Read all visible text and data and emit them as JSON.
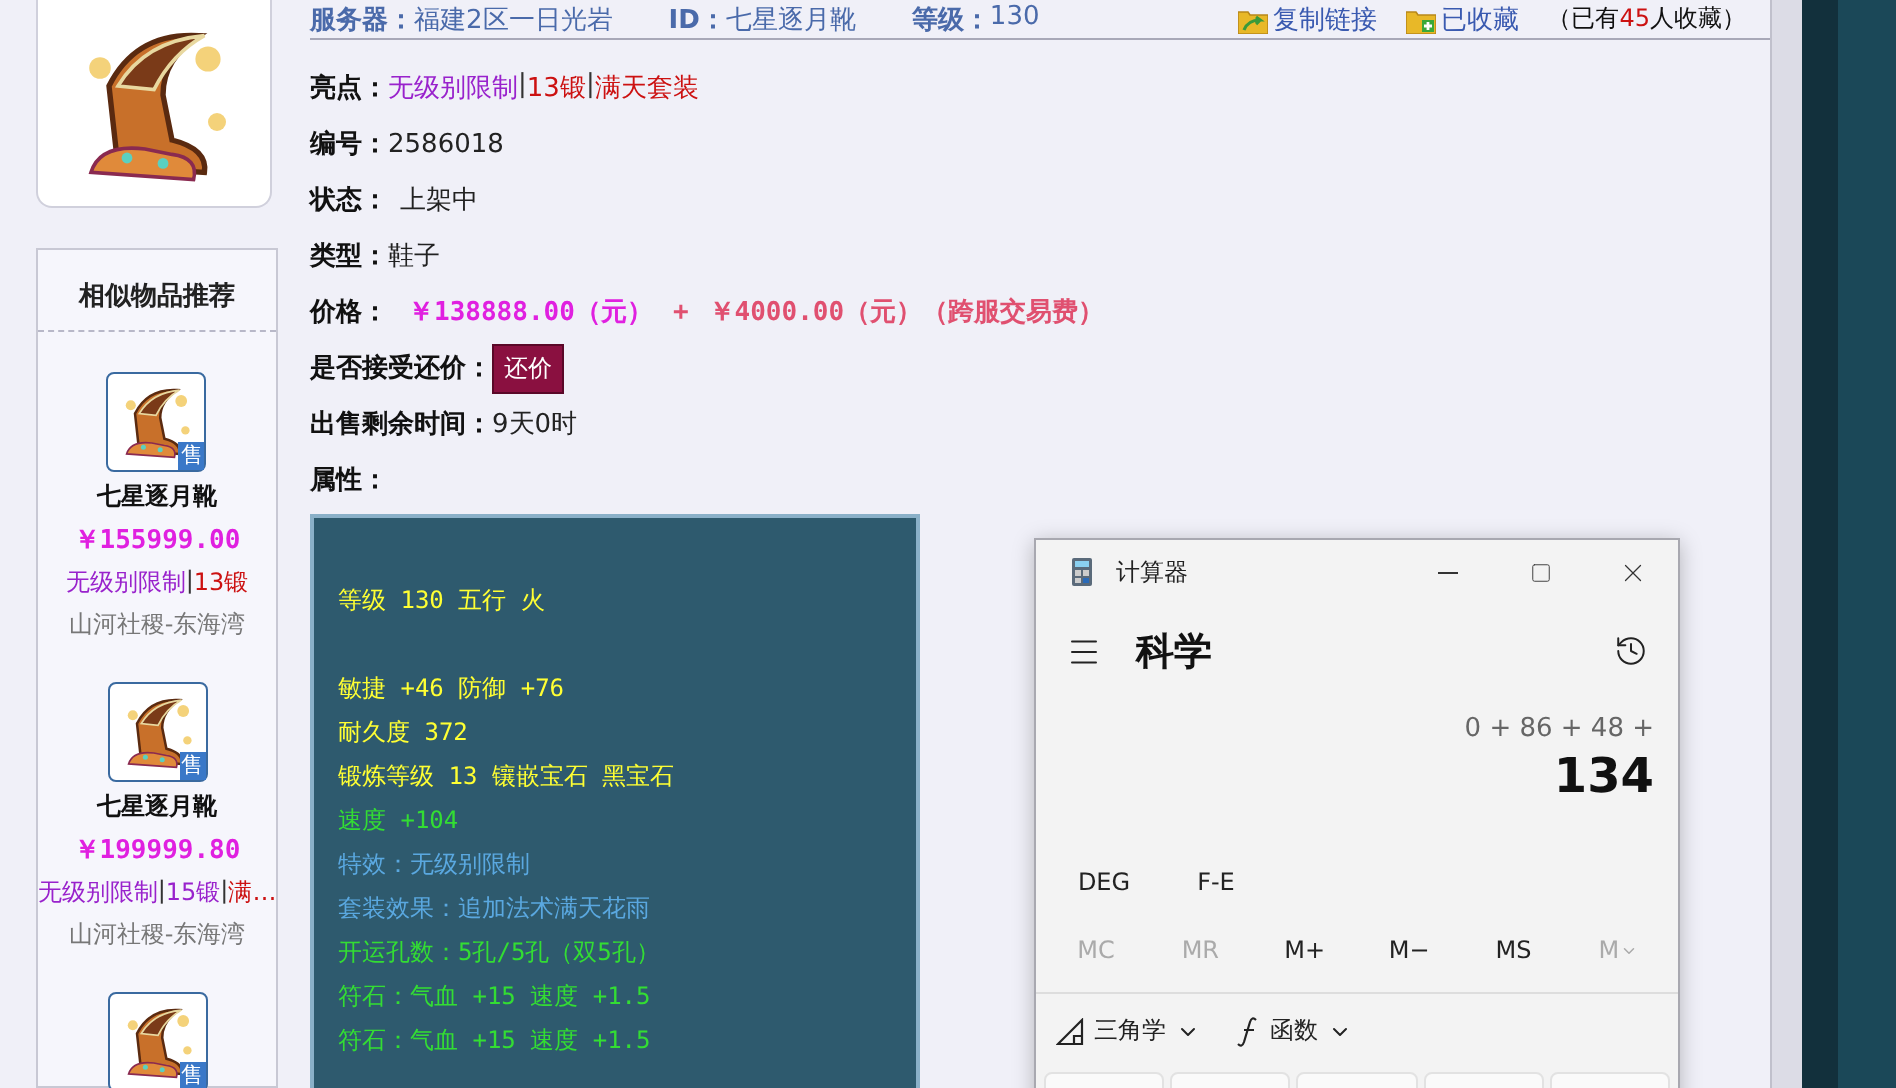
{
  "similar": {
    "title": "相似物品推荐",
    "items": [
      {
        "name": "七星逐月靴",
        "price": "￥155999.00",
        "badge": "售",
        "tags": [
          {
            "text": "无级别限制",
            "color": "#9922cc"
          },
          {
            "text": "|",
            "color": "#333333"
          },
          {
            "text": "13锻",
            "color": "#cc1111"
          }
        ],
        "server": "山河社稷-东海湾"
      },
      {
        "name": "七星逐月靴",
        "price": "￥199999.80",
        "badge": "售",
        "tags": [
          {
            "text": "无级别限制",
            "color": "#9922cc"
          },
          {
            "text": "|",
            "color": "#333333"
          },
          {
            "text": "15锻",
            "color": "#9922cc"
          },
          {
            "text": "|",
            "color": "#333333"
          },
          {
            "text": "满…",
            "color": "#cc1111"
          }
        ],
        "server": "山河社稷-东海湾"
      },
      {
        "badge": "售"
      }
    ]
  },
  "header": {
    "fields": [
      {
        "label": "服务器：",
        "value": "福建2区一日光岩"
      },
      {
        "label": "ID：",
        "value": "七星逐月靴"
      },
      {
        "label": "等级：",
        "value": "130"
      }
    ],
    "links": [
      "复制链接",
      "已收藏"
    ],
    "fav_count": [
      {
        "text": "（已有",
        "color": "#111111"
      },
      {
        "text": "45",
        "color": "#cc1111"
      },
      {
        "text": "人收藏）",
        "color": "#111111"
      }
    ]
  },
  "details": [
    {
      "label": "亮点：",
      "kind": "tags",
      "tags": [
        {
          "text": "无级别限制",
          "color": "#9922cc"
        },
        {
          "text": "|",
          "color": "#333333"
        },
        {
          "text": "13锻",
          "color": "#cc1111"
        },
        {
          "text": "|",
          "color": "#333333"
        },
        {
          "text": "满天套装",
          "color": "#cc1111"
        }
      ]
    },
    {
      "label": "编号：",
      "kind": "text",
      "value": "2586018"
    },
    {
      "label": "状态：",
      "kind": "text",
      "value": "上架中"
    },
    {
      "label": "类型：",
      "kind": "text",
      "value": "鞋子"
    },
    {
      "label": "价格：",
      "kind": "price",
      "parts": [
        {
          "text": "￥138888.00（元）",
          "color": "#e020e0"
        },
        {
          "text": "+",
          "color": "#e05070"
        },
        {
          "text": "￥4000.00（元）（跨服交易费）",
          "color": "#e05070"
        }
      ]
    },
    {
      "label": "是否接受还价：",
      "kind": "button",
      "value": "还价"
    },
    {
      "label": "出售剩余时间：",
      "kind": "text",
      "value": "9天0时"
    },
    {
      "label": "属性：",
      "kind": "none"
    }
  ],
  "attributes": [
    [
      {
        "text": "等级 130 五行 火",
        "color": "#ffff33"
      }
    ],
    [
      {
        "text": "敏捷 +46 防御 +76",
        "color": "#ffff33"
      },
      {
        "text": "耐久度 372",
        "color": "#ffff33"
      },
      {
        "text": "锻炼等级 13 镶嵌宝石 黑宝石",
        "color": "#ffff33"
      },
      {
        "text": "速度 +104",
        "color": "#33dd33"
      },
      {
        "text": "特效：无级别限制",
        "color": "#5aa8e0"
      },
      {
        "text": "套装效果：追加法术满天花雨",
        "color": "#5aa8e0"
      },
      {
        "text": "开运孔数：5孔/5孔（双5孔）",
        "color": "#33dd33"
      },
      {
        "text": "符石：气血 +15 速度 +1.5",
        "color": "#33dd33"
      },
      {
        "text": "符石：气血 +15 速度 +1.5",
        "color": "#33dd33"
      }
    ]
  ],
  "calculator": {
    "title": "计算器",
    "mode": "科学",
    "expression": "0 + 86 + 48 +",
    "result": "134",
    "options": [
      "DEG",
      "F-E"
    ],
    "memory": [
      {
        "label": "MC",
        "disabled": true
      },
      {
        "label": "MR",
        "disabled": true
      },
      {
        "label": "M+",
        "disabled": false
      },
      {
        "label": "M−",
        "disabled": false
      },
      {
        "label": "MS",
        "disabled": false
      },
      {
        "label": "M",
        "disabled": true
      }
    ],
    "menus": [
      "三角学",
      "函数"
    ]
  }
}
